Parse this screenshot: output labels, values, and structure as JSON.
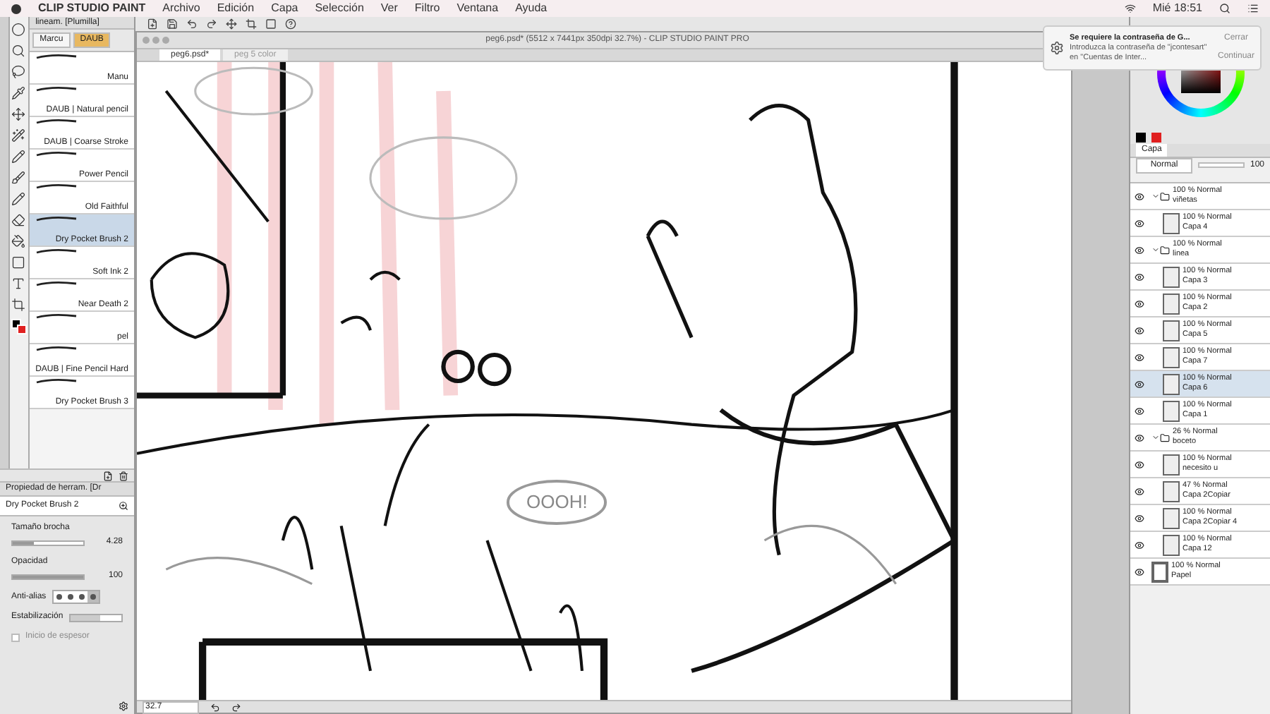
{
  "menu_bar": {
    "app": "CLIP STUDIO PAINT",
    "items": [
      "Archivo",
      "Edición",
      "Capa",
      "Selección",
      "Ver",
      "Filtro",
      "Ventana",
      "Ayuda"
    ],
    "clock": "Mié 18:51"
  },
  "notification": {
    "title": "Se requiere la contraseña de G...",
    "body": "Introduzca la contraseña de \"jcontesart\" en \"Cuentas de Inter...",
    "buttons": [
      "Cerrar",
      "Continuar"
    ]
  },
  "brush_panel": {
    "header": "lineam. [Plumilla]",
    "tabs": [
      {
        "label": "Marcu",
        "selected": false
      },
      {
        "label": "DAUB",
        "selected": true
      }
    ],
    "brushes": [
      {
        "name": "Manu",
        "selected": false
      },
      {
        "name": "DAUB | Natural pencil",
        "selected": false
      },
      {
        "name": "DAUB | Coarse Stroke",
        "selected": false
      },
      {
        "name": "Power Pencil",
        "selected": false
      },
      {
        "name": "Old Faithful",
        "selected": false
      },
      {
        "name": "Dry Pocket Brush 2",
        "selected": true
      },
      {
        "name": "Soft Ink 2",
        "selected": false
      },
      {
        "name": "Near Death 2",
        "selected": false
      },
      {
        "name": "pel",
        "selected": false
      },
      {
        "name": "DAUB | Fine Pencil Hard",
        "selected": false
      },
      {
        "name": "Dry Pocket Brush 3",
        "selected": false
      }
    ]
  },
  "properties": {
    "header": "Propiedad de herram. [Dr",
    "brush": "Dry Pocket Brush 2",
    "size": {
      "label": "Tamaño brocha",
      "value": "4.28",
      "level": 0.3
    },
    "opacity": {
      "label": "Opacidad",
      "value": "100",
      "level": 1
    },
    "antialias": {
      "label": "Anti-alias",
      "options": [
        {
          "selected": false
        },
        {
          "selected": false
        },
        {
          "selected": false
        },
        {
          "selected": true
        }
      ]
    },
    "stabilization": {
      "label": "Estabilización",
      "level": 0.6
    },
    "thickness": {
      "label": "Inicio de espesor",
      "checked": false,
      "disabled": true
    }
  },
  "document": {
    "title": "peg6.psd* (5512 x 7441px 350dpi 32.7%) - CLIP STUDIO PAINT PRO",
    "tabs": [
      {
        "label": "peg6.psd*",
        "selected": true
      },
      {
        "label": "peg 5 color",
        "selected": false
      }
    ],
    "bubble_text": "OOOH!",
    "zoom": "32.7"
  },
  "layers": {
    "tab": "Capa",
    "blend": "Normal",
    "opacity": "100",
    "items": [
      {
        "kind": "folder",
        "mode": "100 % Normal",
        "name": "viñetas",
        "expanded": true,
        "selected": false,
        "children": [
          {
            "kind": "layer",
            "mode": "100 % Normal",
            "name": "Capa 4",
            "selected": false
          }
        ]
      },
      {
        "kind": "folder",
        "mode": "100 % Normal",
        "name": "linea",
        "expanded": true,
        "selected": false,
        "children": [
          {
            "kind": "layer",
            "mode": "100 % Normal",
            "name": "Capa 3",
            "selected": false
          },
          {
            "kind": "layer",
            "mode": "100 % Normal",
            "name": "Capa 2",
            "selected": false
          },
          {
            "kind": "layer",
            "mode": "100 % Normal",
            "name": "Capa 5",
            "selected": false
          },
          {
            "kind": "layer",
            "mode": "100 % Normal",
            "name": "Capa 7",
            "selected": false
          },
          {
            "kind": "layer",
            "mode": "100 % Normal",
            "name": "Capa 6",
            "selected": true
          },
          {
            "kind": "layer",
            "mode": "100 % Normal",
            "name": "Capa 1",
            "selected": false
          }
        ]
      },
      {
        "kind": "folder",
        "mode": "26 % Normal",
        "name": "boceto",
        "expanded": true,
        "selected": false,
        "children": [
          {
            "kind": "layer",
            "mode": "100 % Normal",
            "name": "necesito u",
            "selected": false
          },
          {
            "kind": "layer",
            "mode": "47 % Normal",
            "name": "Capa 2Copiar",
            "selected": false
          },
          {
            "kind": "layer",
            "mode": "100 % Normal",
            "name": "Capa 2Copiar 4",
            "selected": false
          },
          {
            "kind": "layer",
            "mode": "100 % Normal",
            "name": "Capa 12",
            "selected": false
          }
        ]
      },
      {
        "kind": "paper",
        "mode": "100 % Normal",
        "name": "Papel",
        "selected": false
      }
    ]
  }
}
